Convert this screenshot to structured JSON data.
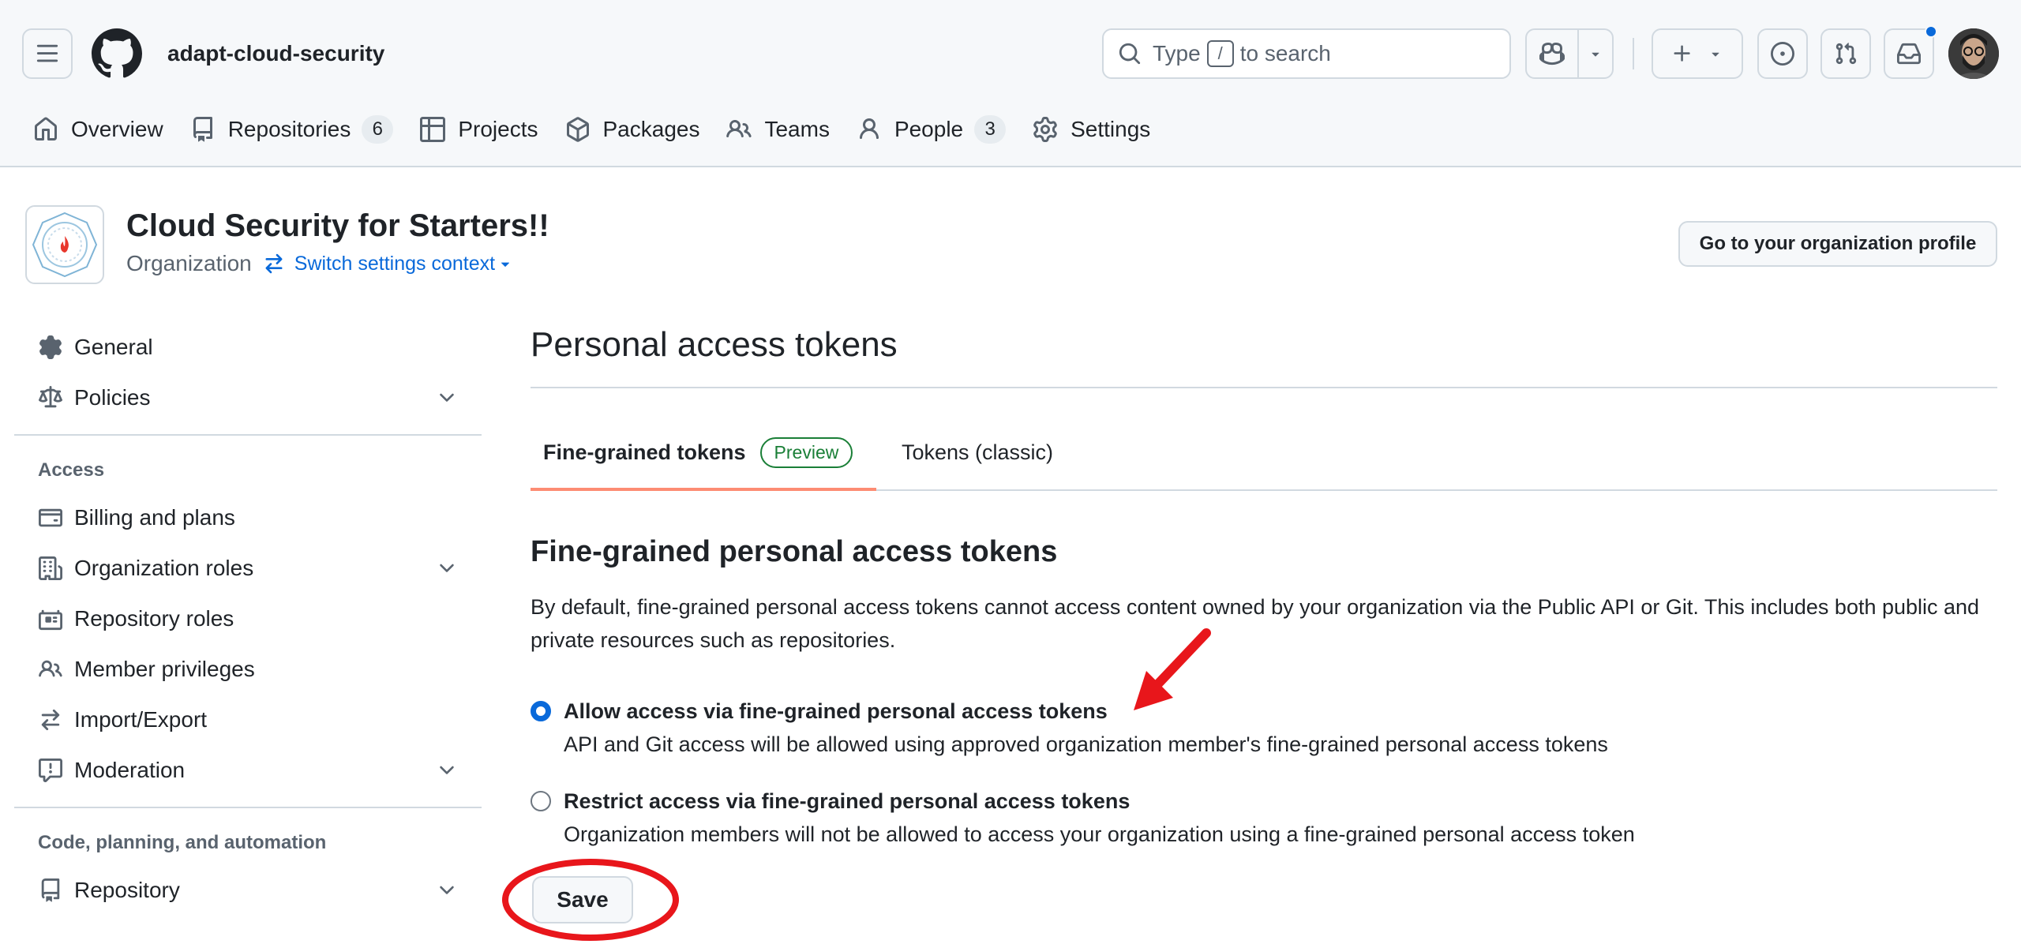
{
  "topbar": {
    "org_name": "adapt-cloud-security",
    "search_prefix": "Type",
    "search_key": "/",
    "search_suffix": "to search"
  },
  "org_nav": [
    {
      "label": "Overview",
      "icon": "home-icon"
    },
    {
      "label": "Repositories",
      "icon": "repo-icon",
      "count": "6"
    },
    {
      "label": "Projects",
      "icon": "table-icon"
    },
    {
      "label": "Packages",
      "icon": "package-icon"
    },
    {
      "label": "Teams",
      "icon": "people-icon"
    },
    {
      "label": "People",
      "icon": "person-icon",
      "count": "3"
    },
    {
      "label": "Settings",
      "icon": "gear-icon"
    }
  ],
  "org": {
    "title": "Cloud Security for Starters!!",
    "type": "Organization",
    "switch_context": "Switch settings context",
    "profile_button": "Go to your organization profile"
  },
  "sidebar": {
    "top_items": [
      {
        "label": "General",
        "icon": "gear-icon"
      },
      {
        "label": "Policies",
        "icon": "law-icon",
        "expandable": true
      }
    ],
    "access_heading": "Access",
    "access_items": [
      {
        "label": "Billing and plans",
        "icon": "credit-card-icon"
      },
      {
        "label": "Organization roles",
        "icon": "organization-icon",
        "expandable": true
      },
      {
        "label": "Repository roles",
        "icon": "id-badge-icon"
      },
      {
        "label": "Member privileges",
        "icon": "people-icon"
      },
      {
        "label": "Import/Export",
        "icon": "arrow-switch-icon"
      },
      {
        "label": "Moderation",
        "icon": "report-icon",
        "expandable": true
      }
    ],
    "code_heading": "Code, planning, and automation",
    "code_items": [
      {
        "label": "Repository",
        "icon": "repo-icon",
        "expandable": true
      }
    ]
  },
  "main": {
    "title": "Personal access tokens",
    "tabs": [
      {
        "label": "Fine-grained tokens",
        "badge": "Preview",
        "selected": true
      },
      {
        "label": "Tokens (classic)",
        "selected": false
      }
    ],
    "section_title": "Fine-grained personal access tokens",
    "description": "By default, fine-grained personal access tokens cannot access content owned by your organization via the Public API or Git. This includes both public and private resources such as repositories.",
    "options": [
      {
        "label": "Allow access via fine-grained personal access tokens",
        "note": "API and Git access will be allowed using approved organization member's fine-grained personal access tokens",
        "checked": true
      },
      {
        "label": "Restrict access via fine-grained personal access tokens",
        "note": "Organization members will not be allowed to access your organization using a fine-grained personal access token",
        "checked": false
      }
    ],
    "save_label": "Save"
  },
  "colors": {
    "accent": "#0969da",
    "tab_underline": "#fd8c73",
    "badge_green": "#1a7f37",
    "annotation_red": "#e8161b"
  }
}
